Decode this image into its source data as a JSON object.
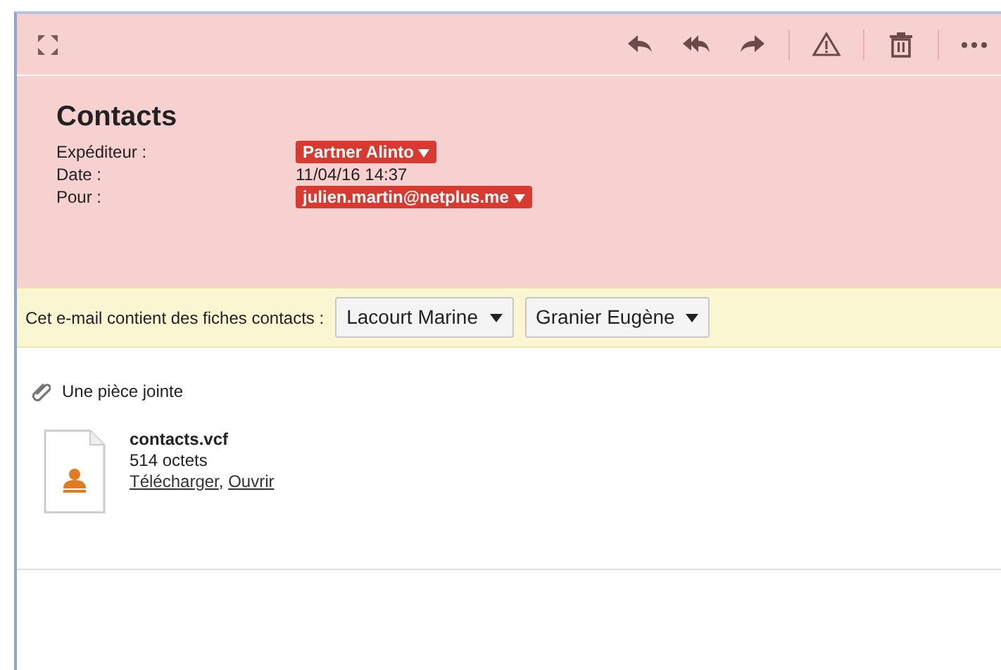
{
  "toolbar": {
    "actions": [
      {
        "kind": "reply"
      },
      {
        "kind": "reply-all"
      },
      {
        "kind": "forward"
      },
      {
        "kind": "sep"
      },
      {
        "kind": "warning"
      },
      {
        "kind": "sep"
      },
      {
        "kind": "trash"
      },
      {
        "kind": "sep"
      },
      {
        "kind": "more"
      }
    ]
  },
  "message": {
    "subject": "Contacts",
    "fields": [
      {
        "label": "Expéditeur :",
        "value": "Partner Alinto",
        "kind": "tag"
      },
      {
        "label": "Date :",
        "value": "11/04/16 14:37",
        "kind": "text"
      },
      {
        "label": "Pour :",
        "value": "julien.martin@netplus.me",
        "kind": "tag"
      }
    ]
  },
  "contacts_bar": {
    "text": "Cet e-mail contient des fiches contacts :",
    "contacts": [
      "Lacourt Marine",
      "Granier Eugène"
    ]
  },
  "attachments": {
    "title": "Une pièce jointe",
    "files": [
      {
        "name": "contacts.vcf",
        "size": "514 octets",
        "links": [
          "Télécharger",
          "Ouvrir"
        ],
        "separator": ","
      }
    ]
  }
}
